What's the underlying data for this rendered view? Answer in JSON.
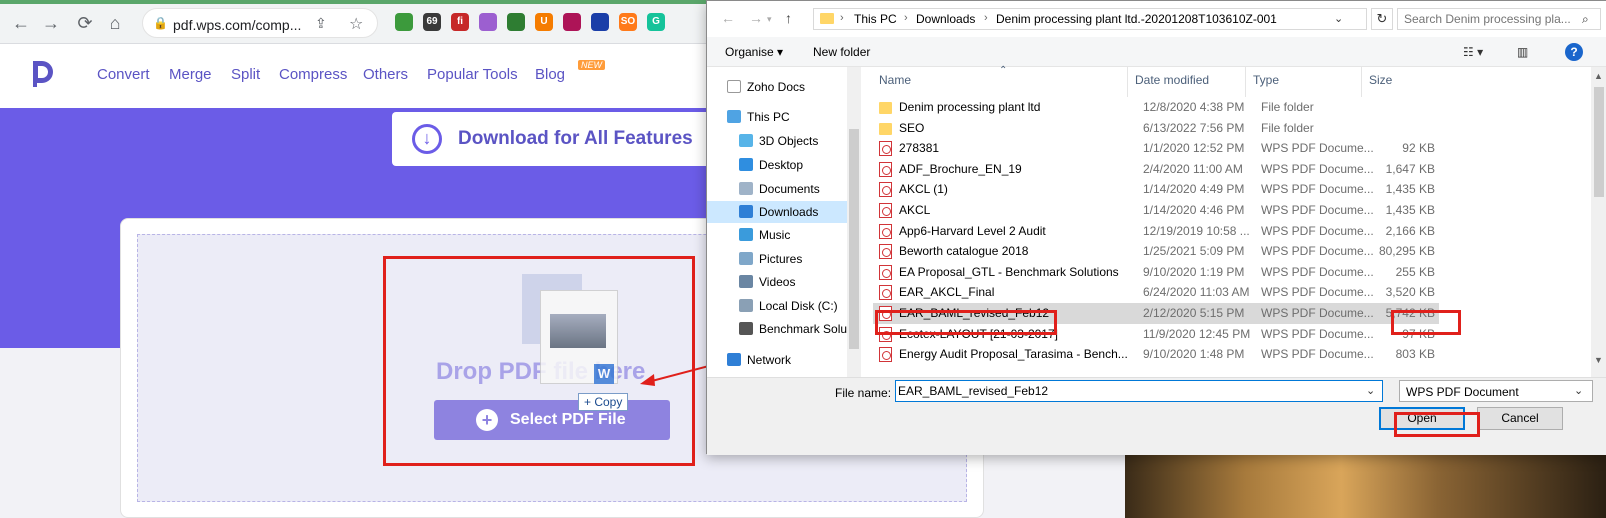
{
  "browser": {
    "url": "pdf.wps.com/comp...",
    "extensions": [
      {
        "name": "green-circle-ext",
        "color": "#3c9a3c",
        "text": ""
      },
      {
        "name": "69-ext",
        "color": "#3a3a3a",
        "text": "69"
      },
      {
        "name": "red-ext",
        "color": "#c62828",
        "text": "fi"
      },
      {
        "name": "feather-ext",
        "color": "#9c5fd0",
        "text": ""
      },
      {
        "name": "globe-ext",
        "color": "#2e7d32",
        "text": ""
      },
      {
        "name": "u-ext",
        "color": "#f57c00",
        "text": "U"
      },
      {
        "name": "pink-ext",
        "color": "#ad1457",
        "text": ""
      },
      {
        "name": "wave-ext",
        "color": "#1a3ea8",
        "text": ""
      },
      {
        "name": "so-ext",
        "color": "#ff7a1a",
        "text": "SO"
      },
      {
        "name": "grammarly-ext",
        "color": "#15c39a",
        "text": "G"
      }
    ]
  },
  "site": {
    "nav": [
      "Convert",
      "Merge",
      "Split",
      "Compress",
      "Others",
      "Popular Tools",
      "Blog"
    ],
    "new_badge": "NEW",
    "download_label": "Download for All Features",
    "drop_text": "Drop PDF file here",
    "select_label": "Select PDF File",
    "copy_tip": "+ Copy"
  },
  "dialog": {
    "breadcrumb": [
      "This PC",
      "Downloads",
      "Denim processing plant ltd.-20201208T103610Z-001"
    ],
    "search_placeholder": "Search Denim processing pla...",
    "commands": {
      "organise": "Organise ▾",
      "new_folder": "New folder"
    },
    "nav_items": [
      {
        "label": "Zoho Docs",
        "icon": "doc-icon",
        "color": "#ffffff",
        "indent": 0
      },
      {
        "label": "This PC",
        "icon": "computer-icon",
        "color": "#4fa3e3",
        "indent": 0
      },
      {
        "label": "3D Objects",
        "icon": "cube-icon",
        "color": "#57b4e8",
        "indent": 1
      },
      {
        "label": "Desktop",
        "icon": "desktop-icon",
        "color": "#2f8ee0",
        "indent": 1
      },
      {
        "label": "Documents",
        "icon": "documents-icon",
        "color": "#9fb3c8",
        "indent": 1
      },
      {
        "label": "Downloads",
        "icon": "download-arrow-icon",
        "color": "#2f7fd6",
        "indent": 1,
        "selected": true
      },
      {
        "label": "Music",
        "icon": "music-icon",
        "color": "#3a9bdc",
        "indent": 1
      },
      {
        "label": "Pictures",
        "icon": "pictures-icon",
        "color": "#7fa7c9",
        "indent": 1
      },
      {
        "label": "Videos",
        "icon": "videos-icon",
        "color": "#6a86a3",
        "indent": 1
      },
      {
        "label": "Local Disk (C:)",
        "icon": "disk-icon",
        "color": "#8aa0b5",
        "indent": 1
      },
      {
        "label": "Benchmark Solu",
        "icon": "drive-icon",
        "color": "#555555",
        "indent": 1
      },
      {
        "label": "Network",
        "icon": "network-icon",
        "color": "#2f7fd6",
        "indent": 0
      }
    ],
    "columns": {
      "name": "Name",
      "date": "Date modified",
      "type": "Type",
      "size": "Size"
    },
    "files": [
      {
        "name": "Denim processing plant ltd",
        "date": "12/8/2020 4:38 PM",
        "type": "File folder",
        "size": "",
        "kind": "folder"
      },
      {
        "name": "SEO",
        "date": "6/13/2022 7:56 PM",
        "type": "File folder",
        "size": "",
        "kind": "folder"
      },
      {
        "name": "278381",
        "date": "1/1/2020 12:52 PM",
        "type": "WPS PDF Docume...",
        "size": "92 KB",
        "kind": "pdf"
      },
      {
        "name": "ADF_Brochure_EN_19",
        "date": "2/4/2020 11:00 AM",
        "type": "WPS PDF Docume...",
        "size": "1,647 KB",
        "kind": "pdf"
      },
      {
        "name": "AKCL (1)",
        "date": "1/14/2020 4:49 PM",
        "type": "WPS PDF Docume...",
        "size": "1,435 KB",
        "kind": "pdf"
      },
      {
        "name": "AKCL",
        "date": "1/14/2020 4:46 PM",
        "type": "WPS PDF Docume...",
        "size": "1,435 KB",
        "kind": "pdf"
      },
      {
        "name": "App6-Harvard Level 2 Audit",
        "date": "12/19/2019 10:58 ...",
        "type": "WPS PDF Docume...",
        "size": "2,166 KB",
        "kind": "pdf"
      },
      {
        "name": "Beworth catalogue 2018",
        "date": "1/25/2021 5:09 PM",
        "type": "WPS PDF Docume...",
        "size": "80,295 KB",
        "kind": "pdf"
      },
      {
        "name": "EA Proposal_GTL - Benchmark Solutions",
        "date": "9/10/2020 1:19 PM",
        "type": "WPS PDF Docume...",
        "size": "255 KB",
        "kind": "pdf"
      },
      {
        "name": "EAR_AKCL_Final",
        "date": "6/24/2020 11:03 AM",
        "type": "WPS PDF Docume...",
        "size": "3,520 KB",
        "kind": "pdf"
      },
      {
        "name": "EAR_BAML_revised_Feb12",
        "date": "2/12/2020 5:15 PM",
        "type": "WPS PDF Docume...",
        "size": "5,742 KB",
        "kind": "pdf",
        "selected": true
      },
      {
        "name": "Ecotex-LAYOUT [21-03-2017]",
        "date": "11/9/2020 12:45 PM",
        "type": "WPS PDF Docume...",
        "size": "97 KB",
        "kind": "pdf"
      },
      {
        "name": "Energy Audit Proposal_Tarasima - Bench...",
        "date": "9/10/2020 1:48 PM",
        "type": "WPS PDF Docume...",
        "size": "803 KB",
        "kind": "pdf"
      }
    ],
    "filename_label": "File name:",
    "filename_value": "EAR_BAML_revised_Feb12",
    "filetype": "WPS PDF Document",
    "open_label": "Open",
    "cancel_label": "Cancel"
  },
  "colors": {
    "accent": "#6b5ce7",
    "highlight": "#e0201b"
  }
}
